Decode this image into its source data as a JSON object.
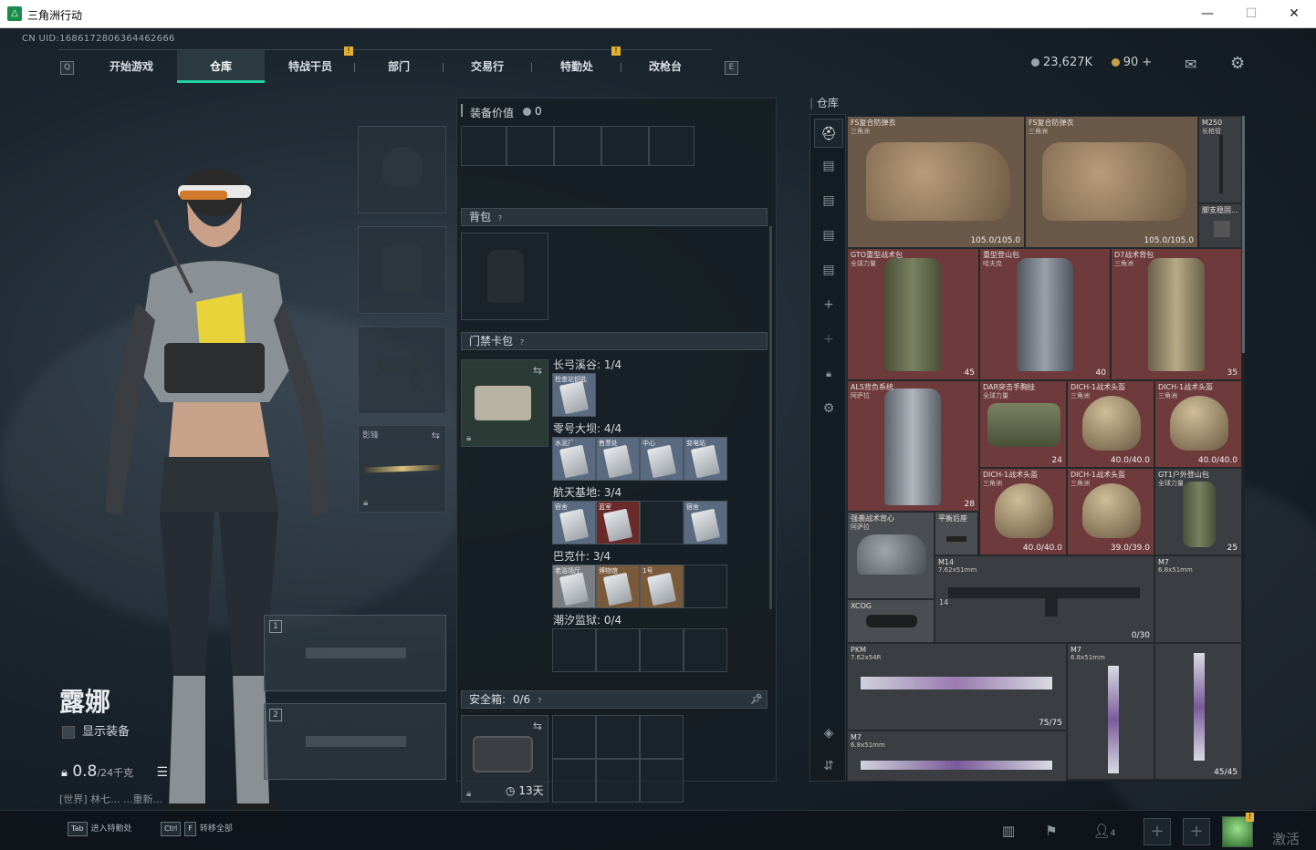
{
  "window": {
    "title": "三角洲行动",
    "controls": [
      "—",
      "☐",
      "✕"
    ]
  },
  "uid": "CN UID:1686172806364462666",
  "nav": {
    "key_left": "Q",
    "key_right": "E",
    "tabs": [
      "开始游戏",
      "仓库",
      "特战干员",
      "部门",
      "交易行",
      "特勤处",
      "改枪台"
    ],
    "active": "仓库",
    "badge": "!"
  },
  "currency": {
    "coins": "23,627K",
    "gold": "90 +"
  },
  "character": {
    "name": "露娜",
    "show_equipment": "显示装备",
    "weight": "0.8",
    "weight_max": "/24千克",
    "chat": "[世界] 林七...   ...重新..."
  },
  "equip_slots": {
    "melee_label": "影锋"
  },
  "weapon_slots": [
    "1",
    "2"
  ],
  "mid": {
    "equip_value_label": "装备价值",
    "equip_value": "0",
    "backpack_label": "背包",
    "keycard_label": "门禁卡包",
    "key_groups": [
      {
        "label": "长弓溪谷: 1/4",
        "cards": [
          {
            "name": "检查站钥匙",
            "tone": "blue"
          }
        ]
      },
      {
        "label": "零号大坝: 4/4",
        "cards": [
          {
            "name": "水泥厂",
            "tone": "blue"
          },
          {
            "name": "售票处",
            "tone": "blue"
          },
          {
            "name": "中心",
            "tone": "blue"
          },
          {
            "name": "变电站",
            "tone": "blue"
          }
        ]
      },
      {
        "label": "航天基地: 3/4",
        "cards": [
          {
            "name": "宿舍",
            "tone": "blue"
          },
          {
            "name": "蓝室",
            "tone": "red"
          },
          {
            "name": "",
            "tone": "empty"
          },
          {
            "name": "宿舍",
            "tone": "blue"
          }
        ]
      },
      {
        "label": "巴克什: 3/4",
        "cards": [
          {
            "name": "老浴场厅",
            "tone": "gray"
          },
          {
            "name": "博物馆",
            "tone": "brown"
          },
          {
            "name": "1号",
            "tone": "brown"
          },
          {
            "name": "",
            "tone": "empty"
          }
        ]
      },
      {
        "label": "潮汐监狱: 0/4",
        "cards": [
          {
            "name": "",
            "tone": "empty"
          },
          {
            "name": "",
            "tone": "empty"
          },
          {
            "name": "",
            "tone": "empty"
          },
          {
            "name": "",
            "tone": "empty"
          }
        ]
      }
    ],
    "safe_box_label": "安全箱:",
    "safe_box_value": "0/6",
    "safe_box_days": "13天"
  },
  "stash": {
    "header": "仓库",
    "items": [
      {
        "name": "FS复合防弹衣",
        "sub": "三角洲",
        "tone": "tan",
        "br": "105.0/105.0"
      },
      {
        "name": "FS复合防弹衣",
        "sub": "三角洲",
        "tone": "tan",
        "br": "105.0/105.0"
      },
      {
        "name": "M250",
        "sub": "长枪管",
        "tone": "dark",
        "br": ""
      },
      {
        "name": "脚支稳固...",
        "sub": "",
        "tone": "dark",
        "br": ""
      },
      {
        "name": "GTO重型战术包",
        "sub": "全球力量",
        "tone": "red",
        "br": "45"
      },
      {
        "name": "重型登山包",
        "sub": "哈夫克",
        "tone": "red",
        "br": "40"
      },
      {
        "name": "D7战术背包",
        "sub": "三角洲",
        "tone": "red",
        "br": "35"
      },
      {
        "name": "ALS背负系统",
        "sub": "阿萨拉",
        "tone": "red",
        "br": "28"
      },
      {
        "name": "DAR突击手胸挂",
        "sub": "全球力量",
        "tone": "red",
        "br": "24"
      },
      {
        "name": "DICH-1战术头盔",
        "sub": "三角洲",
        "tone": "red",
        "br": "40.0/40.0"
      },
      {
        "name": "DICH-1战术头盔",
        "sub": "三角洲",
        "tone": "red",
        "br": "40.0/40.0"
      },
      {
        "name": "DICH-1战术头盔",
        "sub": "三角洲",
        "tone": "red",
        "br": "40.0/40.0"
      },
      {
        "name": "DICH-1战术头盔",
        "sub": "三角洲",
        "tone": "red",
        "br": "39.0/39.0"
      },
      {
        "name": "GT1户外登山包",
        "sub": "全球力量",
        "tone": "dark",
        "br": "25"
      },
      {
        "name": "强袭战术背心",
        "sub": "阿萨拉",
        "tone": "gray",
        "br": ""
      },
      {
        "name": "平衡后座",
        "sub": "",
        "tone": "gray",
        "br": ""
      },
      {
        "name": "M14",
        "sub": "7.62x51mm",
        "tone": "dark",
        "br": "0/30"
      },
      {
        "name": "M7",
        "sub": "6.8x51mm",
        "tone": "dark",
        "br": ""
      },
      {
        "name": "XCOG",
        "sub": "",
        "tone": "gray",
        "br": ""
      },
      {
        "name": "PKM",
        "sub": "7.62x54R",
        "tone": "dark",
        "br": "75/75"
      },
      {
        "name": "M7",
        "sub": "6.8x51mm",
        "tone": "dark",
        "br": ""
      },
      {
        "name": "M7",
        "sub": "6.8x51mm",
        "tone": "dark",
        "br": "45/45"
      }
    ],
    "bl_badges": {
      "m14": "14"
    }
  },
  "bottom": {
    "hint1_key": "Tab",
    "hint1_text": "进入特勤处",
    "hint2_key1": "Ctrl",
    "hint2_key2": "F",
    "hint2_text": "转移全部",
    "friends_count": "4",
    "watermark": "激活"
  },
  "colors": {
    "accent": "#1fd3a0",
    "badge": "#e0b030",
    "stash_red": "#6e3a3c",
    "stash_tan": "#6a5848"
  },
  "icons": [
    "search-icon",
    "mail-icon",
    "gear-icon",
    "helmet-icon",
    "armor-icon",
    "lock-icon",
    "swap-icon",
    "pin-icon",
    "clock-icon",
    "layers-icon",
    "stats-icon",
    "flag-icon",
    "friends-icon",
    "plus-icon"
  ]
}
